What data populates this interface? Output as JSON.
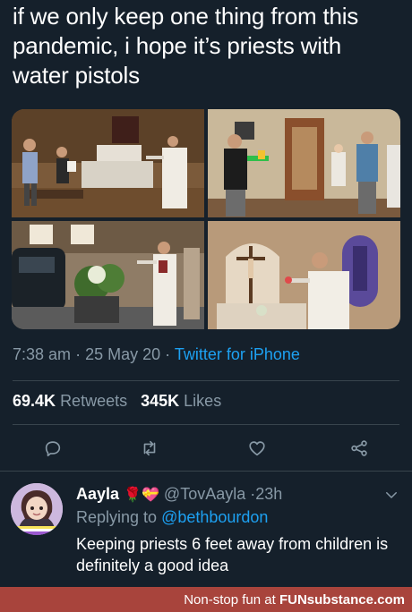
{
  "tweet": {
    "text": "if we only keep one thing from this pandemic, i hope it’s priests with water pistols",
    "time": "7:38 am",
    "date": "25 May 20",
    "client": "Twitter for iPhone",
    "retweets_count": "69.4K",
    "retweets_label": "Retweets",
    "likes_count": "345K",
    "likes_label": "Likes"
  },
  "actions": [
    {
      "icon": "reply-icon"
    },
    {
      "icon": "retweet-icon"
    },
    {
      "icon": "like-icon"
    },
    {
      "icon": "share-icon"
    }
  ],
  "reply": {
    "display_name": "Aayla",
    "emojis": "🌹💝",
    "handle": "@TovAayla",
    "time": "23h",
    "replying_to_label": "Replying to",
    "replying_to_user": "@bethbourdon",
    "text": "Keeping priests 6 feet away from children is definitely a good idea"
  },
  "footer": {
    "prefix": "Non-stop fun at",
    "brand": "FUNsubstance.com"
  },
  "colors": {
    "background": "#15202b",
    "secondary_text": "#8899a6",
    "link": "#1da1f2",
    "divider": "#38444d",
    "footer_bar": "#a8443c"
  }
}
